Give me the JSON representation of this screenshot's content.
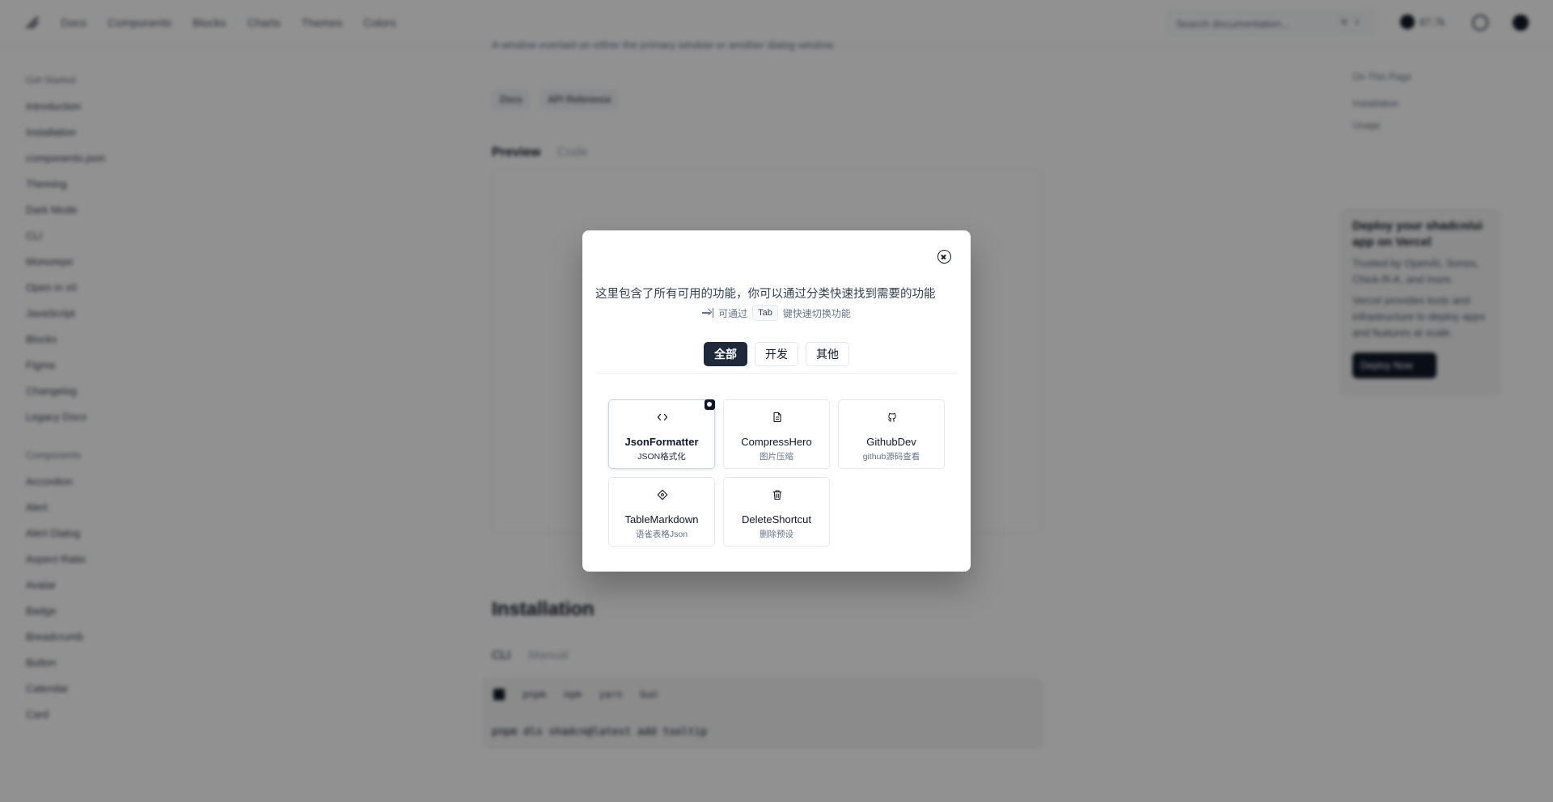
{
  "background": {
    "nav": {
      "links": [
        "Docs",
        "Components",
        "Blocks",
        "Charts",
        "Themes",
        "Colors"
      ],
      "search_placeholder": "Search documentation...",
      "search_kbd_1": "⌘",
      "search_kbd_2": "K",
      "github_stars": "87.7k"
    },
    "sidebar": {
      "section1_title": "Get Started",
      "section1_items": [
        "Introduction",
        "Installation",
        "components.json",
        "Theming",
        "Dark Mode",
        "CLI",
        "Monorepo",
        "Open in v0",
        "JavaScript",
        "Blocks",
        "Figma",
        "Changelog",
        "Legacy Docs"
      ],
      "section2_title": "Components",
      "section2_items": [
        "Accordion",
        "Alert",
        "Alert Dialog",
        "Aspect Ratio",
        "Avatar",
        "Badge",
        "Breadcrumb",
        "Button",
        "Calendar",
        "Card"
      ]
    },
    "main": {
      "description": "A window overlaid on either the primary window or another dialog window.",
      "pills": [
        "Docs",
        "API Reference"
      ],
      "tab_preview": "Preview",
      "tab_code": "Code",
      "install_title": "Installation",
      "install_tab_cli": "CLI",
      "install_tab_manual": "Manual",
      "pkg_managers": [
        "pnpm",
        "npm",
        "yarn",
        "bun"
      ],
      "command": "pnpm dlx shadcn@latest add tooltip"
    },
    "toc": {
      "title": "On This Page",
      "items": [
        "Installation",
        "Usage"
      ]
    },
    "promo": {
      "title": "Deploy your shadcn/ui app on Vercel",
      "text1": "Trusted by OpenAI, Sonos, Chick-fil-A, and more.",
      "text2": "Vercel provides tools and infrastructure to deploy apps and features at scale.",
      "button": "Deploy Now"
    }
  },
  "modal": {
    "description": "这里包含了所有可用的功能，你可以通过分类快速找到需要的功能",
    "hint_prefix": "可通过",
    "hint_key": "Tab",
    "hint_suffix": "键快速切换功能",
    "categories": [
      {
        "label": "全部",
        "active": true
      },
      {
        "label": "开发",
        "active": false
      },
      {
        "label": "其他",
        "active": false
      }
    ],
    "tools": [
      {
        "name": "JsonFormatter",
        "sub": "JSON格式化",
        "icon": "code-icon",
        "selected": true
      },
      {
        "name": "CompressHero",
        "sub": "图片压缩",
        "icon": "file-text-icon",
        "selected": false
      },
      {
        "name": "GithubDev",
        "sub": "github源码查看",
        "icon": "github-icon",
        "selected": false
      },
      {
        "name": "TableMarkdown",
        "sub": "语雀表格Json",
        "icon": "diamond-icon",
        "selected": false
      },
      {
        "name": "DeleteShortcut",
        "sub": "删除预设",
        "icon": "trash-icon",
        "selected": false
      }
    ]
  }
}
